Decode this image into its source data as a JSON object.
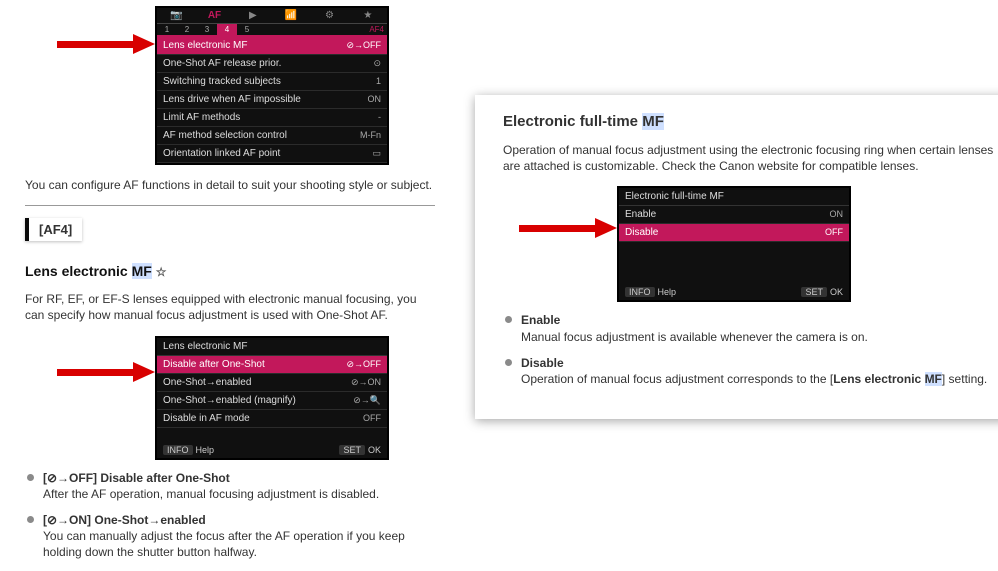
{
  "left": {
    "menu1": {
      "tabs": [
        "📷",
        "AF",
        "▶",
        "📶",
        "⚙",
        "★"
      ],
      "subtabs": [
        "1",
        "2",
        "3",
        "4",
        "5"
      ],
      "subtabs_active": "4",
      "subtabs_tag": "AF4",
      "rows": [
        {
          "label": "Lens electronic MF",
          "val": "⊘→OFF",
          "selected": true
        },
        {
          "label": "One-Shot AF release prior.",
          "val": "⊙"
        },
        {
          "label": "Switching tracked subjects",
          "val": "1"
        },
        {
          "label": "Lens drive when AF impossible",
          "val": "ON"
        },
        {
          "label": "Limit AF methods",
          "val": "-"
        },
        {
          "label": "AF method selection control",
          "val": "M-Fn"
        },
        {
          "label": "Orientation linked AF point",
          "val": "▭"
        }
      ]
    },
    "intro": "You can configure AF functions in detail to suit your shooting style or subject.",
    "section_tag": "[AF4]",
    "subhead": "Lens electronic ",
    "subhead_hl": "MF",
    "subhead_star": "☆",
    "para": "For RF, EF, or EF-S lenses equipped with electronic manual focusing, you can specify how manual focus adjustment is used with One-Shot AF.",
    "menu2": {
      "title": "Lens electronic MF",
      "rows": [
        {
          "label": "Disable after One-Shot",
          "val": "⊘→OFF",
          "selected": true
        },
        {
          "label": "One-Shot→enabled",
          "val": "⊘→ON"
        },
        {
          "label": "One-Shot→enabled (magnify)",
          "val": "⊘→🔍"
        },
        {
          "label": "Disable in AF mode",
          "val": "OFF"
        }
      ],
      "foot_info": "INFO",
      "foot_help": "Help",
      "foot_set": "SET",
      "foot_ok": "OK"
    },
    "options": [
      {
        "code": "[⊘→OFF] Disable after One-Shot",
        "desc": "After the AF operation, manual focusing adjustment is disabled."
      },
      {
        "code": "[⊘→ON] One-Shot→enabled",
        "desc": "You can manually adjust the focus after the AF operation if you keep holding down the shutter button halfway."
      }
    ]
  },
  "right": {
    "head_pre": "Electronic full-time ",
    "head_hl": "MF",
    "para": "Operation of manual focus adjustment using the electronic focusing ring when certain lenses are attached is customizable. Check the Canon website for compatible lenses.",
    "menu": {
      "title": "Electronic full-time MF",
      "rows": [
        {
          "label": "Enable",
          "val": "ON"
        },
        {
          "label": "Disable",
          "val": "OFF",
          "selected": true
        }
      ],
      "foot_info": "INFO",
      "foot_help": "Help",
      "foot_set": "SET",
      "foot_ok": "OK"
    },
    "options": [
      {
        "term": "Enable",
        "desc": "Manual focus adjustment is available whenever the camera is on."
      },
      {
        "term": "Disable",
        "desc_pre": "Operation of manual focus adjustment corresponds to the [",
        "desc_bold": "Lens electronic ",
        "desc_hl": "MF",
        "desc_post": "] setting."
      }
    ]
  }
}
